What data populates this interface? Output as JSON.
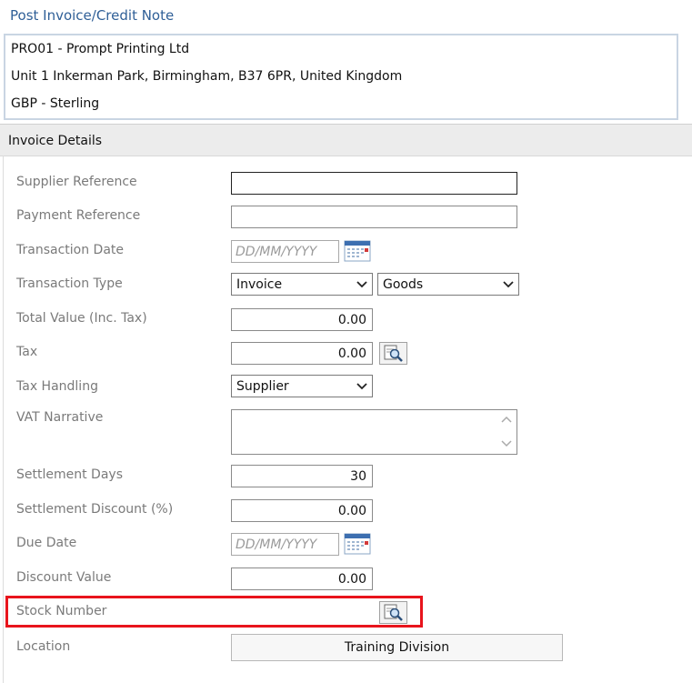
{
  "page": {
    "title": "Post Invoice/Credit Note"
  },
  "supplier_info": {
    "name": "PRO01 - Prompt Printing Ltd",
    "address": "Unit 1 Inkerman Park, Birmingham, B37 6PR, United Kingdom",
    "currency": "GBP - Sterling"
  },
  "section": {
    "title": "Invoice Details"
  },
  "form": {
    "supplier_reference": {
      "label": "Supplier Reference",
      "value": ""
    },
    "payment_reference": {
      "label": "Payment Reference",
      "value": ""
    },
    "transaction_date": {
      "label": "Transaction Date",
      "placeholder": "DD/MM/YYYY"
    },
    "transaction_type": {
      "label": "Transaction Type",
      "value": "Invoice",
      "category": "Goods"
    },
    "total_value": {
      "label": "Total Value (Inc. Tax)",
      "value": "0.00"
    },
    "tax": {
      "label": "Tax",
      "value": "0.00"
    },
    "tax_handling": {
      "label": "Tax Handling",
      "value": "Supplier"
    },
    "vat_narrative": {
      "label": "VAT Narrative",
      "value": ""
    },
    "settlement_days": {
      "label": "Settlement Days",
      "value": "30"
    },
    "settlement_discount": {
      "label": "Settlement Discount (%)",
      "value": "0.00"
    },
    "due_date": {
      "label": "Due Date",
      "placeholder": "DD/MM/YYYY"
    },
    "discount_value": {
      "label": "Discount Value",
      "value": "0.00"
    },
    "stock_number": {
      "label": "Stock Number"
    },
    "location": {
      "label": "Location",
      "value": "Training Division"
    }
  },
  "colors": {
    "title": "#2f5f97",
    "highlight_border": "#e8141c",
    "label": "#7a7a7a"
  }
}
